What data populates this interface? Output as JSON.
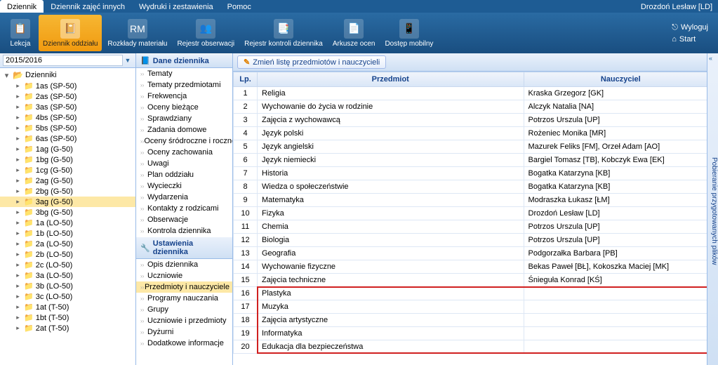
{
  "tabs": [
    "Dziennik",
    "Dziennik zajęć innych",
    "Wydruki i zestawienia",
    "Pomoc"
  ],
  "active_tab": 0,
  "user": "Drozdoń Lesław [LD]",
  "ribbon": [
    {
      "label": "Lekcja",
      "icon": "📋"
    },
    {
      "label": "Dziennik oddziału",
      "icon": "📔"
    },
    {
      "label": "Rozkłady materiału",
      "icon": "RM"
    },
    {
      "label": "Rejestr obserwacji",
      "icon": "👥"
    },
    {
      "label": "Rejestr kontroli dziennika",
      "icon": "📑"
    },
    {
      "label": "Arkusze ocen",
      "icon": "📄"
    },
    {
      "label": "Dostęp mobilny",
      "icon": "📱"
    }
  ],
  "ribbon_active": 1,
  "logout": "Wyloguj",
  "start": "Start",
  "year": "2015/2016",
  "tree_root": "Dzienniki",
  "tree_items": [
    "1as (SP-50)",
    "2as (SP-50)",
    "3as (SP-50)",
    "4bs (SP-50)",
    "5bs (SP-50)",
    "6as (SP-50)",
    "1ag (G-50)",
    "1bg (G-50)",
    "1cg (G-50)",
    "2ag (G-50)",
    "2bg (G-50)",
    "3ag (G-50)",
    "3bg (G-50)",
    "1a (LO-50)",
    "1b (LO-50)",
    "2a (LO-50)",
    "2b (LO-50)",
    "2c (LO-50)",
    "3a (LO-50)",
    "3b (LO-50)",
    "3c (LO-50)",
    "1at (T-50)",
    "1bt (T-50)",
    "2at (T-50)"
  ],
  "tree_selected": 11,
  "sect1_title": "Dane dziennika",
  "sect1_items": [
    "Tematy",
    "Tematy przedmiotami",
    "Frekwencja",
    "Oceny bieżące",
    "Sprawdziany",
    "Zadania domowe",
    "Oceny śródroczne i roczne",
    "Oceny zachowania",
    "Uwagi",
    "Plan oddziału",
    "Wycieczki",
    "Wydarzenia",
    "Kontakty z rodzicami",
    "Obserwacje",
    "Kontrola dziennika"
  ],
  "sect2_title": "Ustawienia dziennika",
  "sect2_items": [
    "Opis dziennika",
    "Uczniowie",
    "Przedmioty i nauczyciele",
    "Programy nauczania",
    "Grupy",
    "Uczniowie i przedmioty",
    "Dyżurni",
    "Dodatkowe informacje"
  ],
  "sect2_selected": 2,
  "toolbar_btn": "Zmień listę przedmiotów i nauczycieli",
  "columns": {
    "lp": "Lp.",
    "subject": "Przedmiot",
    "teacher": "Nauczyciel"
  },
  "rows": [
    {
      "lp": 1,
      "subject": "Religia",
      "teacher": "Kraska Grzegorz [GK]"
    },
    {
      "lp": 2,
      "subject": "Wychowanie do życia w rodzinie",
      "teacher": "Alczyk Natalia [NA]"
    },
    {
      "lp": 3,
      "subject": "Zajęcia z wychowawcą",
      "teacher": "Potrzos Urszula [UP]"
    },
    {
      "lp": 4,
      "subject": "Język polski",
      "teacher": "Rożeniec Monika [MR]"
    },
    {
      "lp": 5,
      "subject": "Język angielski",
      "teacher": "Mazurek Feliks [FM], Orzeł Adam [AO]"
    },
    {
      "lp": 6,
      "subject": "Język niemiecki",
      "teacher": "Bargiel Tomasz [TB], Kobczyk Ewa [EK]"
    },
    {
      "lp": 7,
      "subject": "Historia",
      "teacher": "Bogatka Katarzyna [KB]"
    },
    {
      "lp": 8,
      "subject": "Wiedza o społeczeństwie",
      "teacher": "Bogatka Katarzyna [KB]"
    },
    {
      "lp": 9,
      "subject": "Matematyka",
      "teacher": "Modraszka Łukasz [ŁM]"
    },
    {
      "lp": 10,
      "subject": "Fizyka",
      "teacher": "Drozdoń Lesław [LD]"
    },
    {
      "lp": 11,
      "subject": "Chemia",
      "teacher": "Potrzos Urszula [UP]"
    },
    {
      "lp": 12,
      "subject": "Biologia",
      "teacher": "Potrzos Urszula [UP]"
    },
    {
      "lp": 13,
      "subject": "Geografia",
      "teacher": "Podgorzałka Barbara [PB]"
    },
    {
      "lp": 14,
      "subject": "Wychowanie fizyczne",
      "teacher": "Bekas Paweł [BŁ], Kokoszka Maciej [MK]"
    },
    {
      "lp": 15,
      "subject": "Zajęcia techniczne",
      "teacher": "Śnieguła Konrad [KŚ]"
    },
    {
      "lp": 16,
      "subject": "Plastyka",
      "teacher": ""
    },
    {
      "lp": 17,
      "subject": "Muzyka",
      "teacher": ""
    },
    {
      "lp": 18,
      "subject": "Zajęcia artystyczne",
      "teacher": ""
    },
    {
      "lp": 19,
      "subject": "Informatyka",
      "teacher": ""
    },
    {
      "lp": 20,
      "subject": "Edukacja dla bezpieczeństwa",
      "teacher": ""
    }
  ],
  "highlight_from": 16,
  "side_panel": "Pobieranie przygotowanych plików"
}
